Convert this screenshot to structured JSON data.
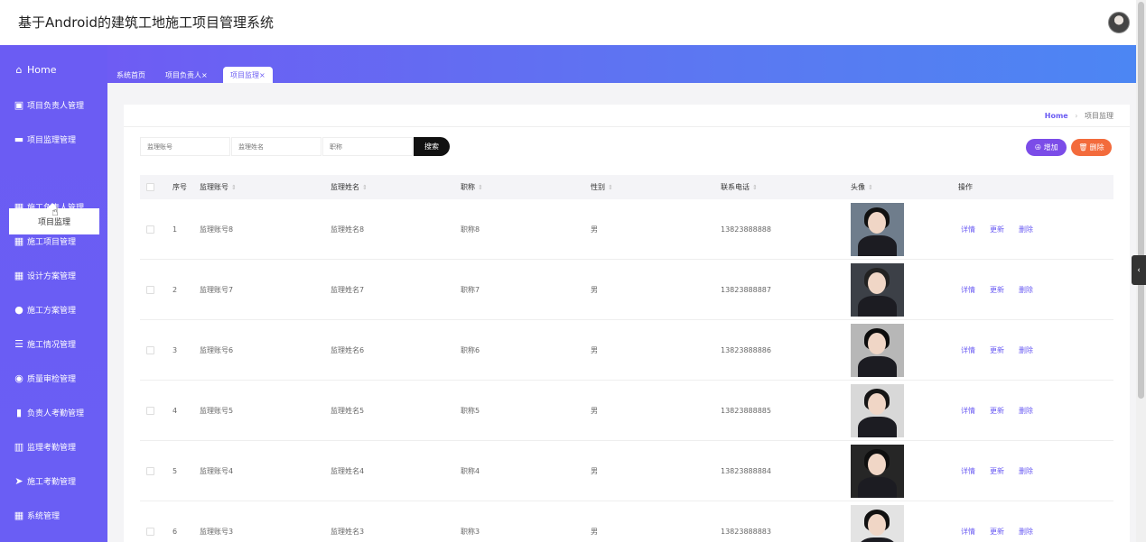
{
  "app": {
    "title": "基于Android的建筑工地施工项目管理系统"
  },
  "sidebar": {
    "items": [
      {
        "label": "Home",
        "icon": "home-icon"
      },
      {
        "label": "项目负责人管理",
        "icon": "clipboard-icon"
      },
      {
        "label": "项目监理管理",
        "icon": "briefcase-icon"
      },
      {
        "label": "施工负责人管理",
        "icon": "grid-icon"
      },
      {
        "label": "施工项目管理",
        "icon": "grid-icon"
      },
      {
        "label": "设计方案管理",
        "icon": "grid-icon"
      },
      {
        "label": "施工方案管理",
        "icon": "user-icon"
      },
      {
        "label": "施工情况管理",
        "icon": "list-icon"
      },
      {
        "label": "质量审检管理",
        "icon": "bulb-icon"
      },
      {
        "label": "负责人考勤管理",
        "icon": "bars-icon"
      },
      {
        "label": "监理考勤管理",
        "icon": "chart-icon"
      },
      {
        "label": "施工考勤管理",
        "icon": "send-icon"
      },
      {
        "label": "系统管理",
        "icon": "grid-icon"
      }
    ],
    "submenu": {
      "label": "项目监理"
    }
  },
  "tabs": [
    {
      "label": "系统首页"
    },
    {
      "label": "项目负责人×"
    },
    {
      "label": "项目监理×"
    }
  ],
  "breadcrumb": {
    "home": "Home",
    "separator": "›",
    "current": "项目监理"
  },
  "search": {
    "account_placeholder": "监理账号",
    "name_placeholder": "监理姓名",
    "title_placeholder": "职称",
    "button": "搜索"
  },
  "actions": {
    "add": "⊕ 增加",
    "delete": "🗑 删除"
  },
  "table": {
    "headers": [
      "序号",
      "监理账号",
      "监理姓名",
      "职称",
      "性别",
      "联系电话",
      "头像",
      "操作"
    ],
    "sort_glyph": "⇕",
    "row_actions": [
      "详情",
      "更新",
      "删除"
    ],
    "rows": [
      {
        "no": "1",
        "account": "监理账号8",
        "name": "监理姓名8",
        "title": "职称8",
        "gender": "男",
        "phone": "13823888888",
        "photo_bg": "#6f7d8c",
        "hair": "#111"
      },
      {
        "no": "2",
        "account": "监理账号7",
        "name": "监理姓名7",
        "title": "职称7",
        "gender": "男",
        "phone": "13823888887",
        "photo_bg": "#3c4047",
        "hair": "#222"
      },
      {
        "no": "3",
        "account": "监理账号6",
        "name": "监理姓名6",
        "title": "职称6",
        "gender": "男",
        "phone": "13823888886",
        "photo_bg": "#b7b7b7",
        "hair": "#0d0d0d"
      },
      {
        "no": "4",
        "account": "监理账号5",
        "name": "监理姓名5",
        "title": "职称5",
        "gender": "男",
        "phone": "13823888885",
        "photo_bg": "#d8d8d8",
        "hair": "#161616"
      },
      {
        "no": "5",
        "account": "监理账号4",
        "name": "监理姓名4",
        "title": "职称4",
        "gender": "男",
        "phone": "13823888884",
        "photo_bg": "#262626",
        "hair": "#0f0f0f"
      },
      {
        "no": "6",
        "account": "监理账号3",
        "name": "监理姓名3",
        "title": "职称3",
        "gender": "男",
        "phone": "13823888883",
        "photo_bg": "#e3e3e3",
        "hair": "#111"
      }
    ]
  }
}
